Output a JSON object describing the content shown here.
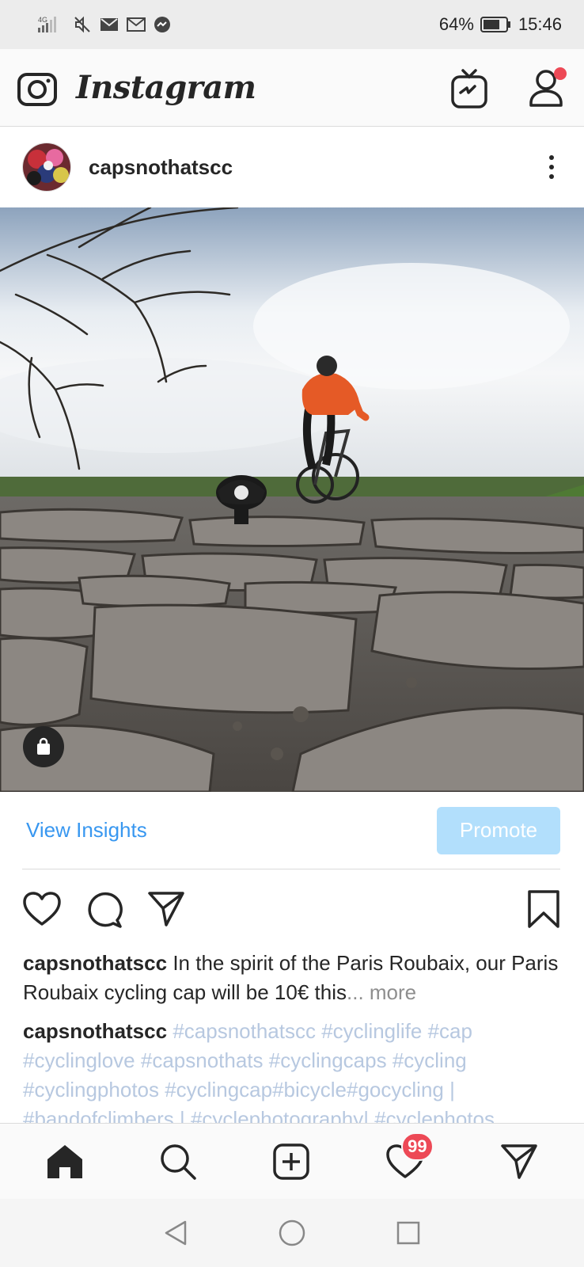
{
  "status_bar": {
    "network": "4G",
    "battery_percent": "64%",
    "time": "15:46"
  },
  "header": {
    "app_name": "Instagram"
  },
  "post": {
    "username": "capsnothatscc",
    "actions": {
      "view_insights": "View Insights",
      "promote": "Promote"
    },
    "caption": {
      "username": "capsnothatscc",
      "text": "In the spirit of the Paris Roubaix, our Paris Roubaix cycling cap will be 10€ this",
      "more": "... more"
    },
    "comment": {
      "username": "capsnothatscc",
      "hashtags": "#capsnothatscc #cyclinglife #cap #cyclinglove #capsnothats #cyclingcaps #cycling #cyclingphotos #cyclingcap#bicycle#gocycling | #bandofclimbers | #cyclephotography| #cyclephotos"
    }
  },
  "bottom_nav": {
    "items": [
      "home-icon",
      "search-icon",
      "add-post-icon",
      "activity-heart-icon",
      "direct-message-icon"
    ],
    "activity_count": "99"
  },
  "colors": {
    "link_blue": "#3897f0",
    "promote_bg": "#b2dffc",
    "badge_red": "#ed4956",
    "hashtag": "#b7c8e0"
  }
}
